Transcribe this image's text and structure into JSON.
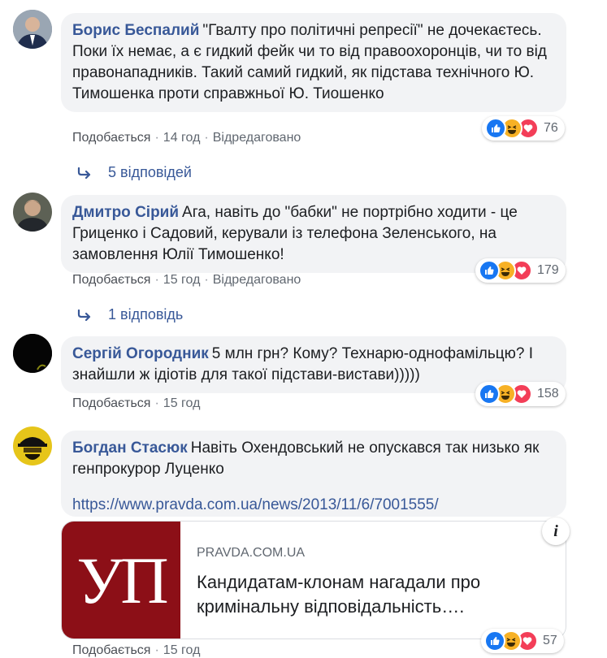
{
  "comments": [
    {
      "author": "Борис Беспалий",
      "text": "\"Гвалту про політичні репресії\" не дочекаєтесь. Поки їх немає, а є гидкий фейк чи то від правоохоронців, чи то від правонападників. Такий самий гидкий, як підстава технічного Ю. Тимошенка проти справжньої Ю. Тиошенко",
      "like": "Подобається",
      "time": "14 год",
      "edited": "Відредаговано",
      "reactions": "76",
      "replies": "5 відповідей"
    },
    {
      "author": "Дмитро Сірий",
      "text": "Ага, навіть до \"бабки\" не портрібно ходити - це Гриценко і Садовий, керували із телефона Зеленського, на замовлення Юлії Тимошенко!",
      "like": "Подобається",
      "time": "15 год",
      "edited": "Відредаговано",
      "reactions": "179",
      "replies": "1 відповідь"
    },
    {
      "author": "Сергій Огородник",
      "text": "5 млн грн? Кому? Технарю-однофамільцю? І знайшли ж ідіотів для такої підстави-вистави)))))",
      "like": "Подобається",
      "time": "15 год",
      "reactions": "158"
    },
    {
      "author": "Богдан Стасюк",
      "text": "Навіть Охендовський не опускався так низько як генпрокурор Луценко",
      "url": "https://www.pravda.com.ua/news/2013/11/6/7001555/",
      "like": "Подобається",
      "time": "15 год",
      "reactions": "57",
      "card": {
        "logo": "УП",
        "domain": "PRAVDA.COM.UA",
        "title": "Кандидатам-клонам нагадали про кримінальну відповідальність…."
      },
      "info_icon": "i"
    }
  ],
  "colors": {
    "link": "#385898",
    "bubble": "#f2f3f5",
    "like": "#1877f2",
    "love": "#f33e58",
    "haha": "#f7b125"
  }
}
